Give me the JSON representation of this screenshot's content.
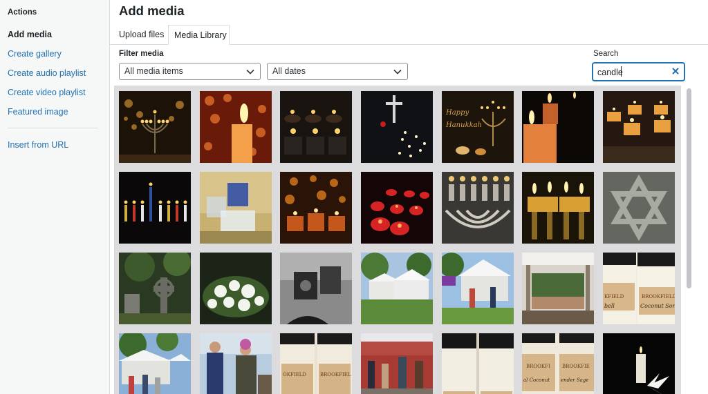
{
  "sidebar": {
    "heading": "Actions",
    "items": [
      {
        "label": "Add media",
        "active": true
      },
      {
        "label": "Create gallery"
      },
      {
        "label": "Create audio playlist"
      },
      {
        "label": "Create video playlist"
      },
      {
        "label": "Featured image"
      },
      {
        "label": "Insert from URL"
      }
    ]
  },
  "frame": {
    "title": "Add media"
  },
  "tabs": [
    {
      "label": "Upload files",
      "active": false
    },
    {
      "label": "Media Library",
      "active": true
    }
  ],
  "filters": {
    "label": "Filter media",
    "type_value": "All media items",
    "date_value": "All dates"
  },
  "search": {
    "label": "Search",
    "value": "candle"
  },
  "colors": {
    "link": "#2271b1",
    "focus": "#2271b1",
    "grid_bg": "#dcdcde"
  },
  "icons": {
    "clear": "close-icon",
    "dropdown": "chevron-down-icon"
  },
  "media_items": [
    "menorah-bokeh",
    "candle-heart-bokeh",
    "tealight-candles-rows",
    "cross-lights-night",
    "happy-hanukkah-menorah",
    "pillar-candles-dark",
    "tealights-in-glass",
    "menorah-colored-candles",
    "glass-candle-holders",
    "votive-candles-bokeh",
    "red-votive-candles",
    "menorah-silver-closeup",
    "menorah-oil-lamps",
    "star-of-david-stone",
    "cemetery-celtic-cross",
    "white-flower-arrangement",
    "bw-candle-holder",
    "market-white-tents",
    "market-tent-shoppers",
    "pavilion-market-stalls",
    "brookfield-candle-jars",
    "market-tents-crowd",
    "market-vendors-masks",
    "brookfield-jars-stacked",
    "market-red-barn",
    "candle-jars-black-lids",
    "brookfield-coconut-sage",
    "candle-lily-dark"
  ]
}
